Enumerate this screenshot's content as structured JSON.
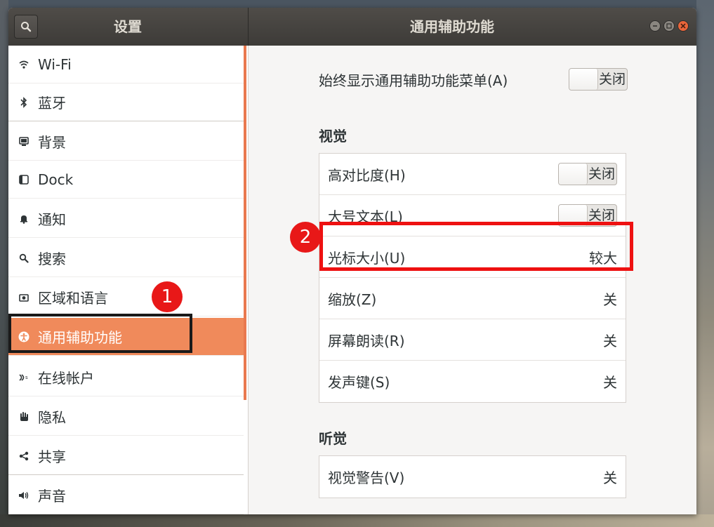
{
  "window": {
    "sidebar_title": "设置",
    "panel_title": "通用辅助功能"
  },
  "sidebar": {
    "items": [
      {
        "label": "Wi-Fi",
        "icon": "wifi-icon"
      },
      {
        "label": "蓝牙",
        "icon": "bluetooth-icon"
      },
      {
        "label": "背景",
        "icon": "background-icon"
      },
      {
        "label": "Dock",
        "icon": "dock-icon"
      },
      {
        "label": "通知",
        "icon": "bell-icon"
      },
      {
        "label": "搜索",
        "icon": "search-icon"
      },
      {
        "label": "区域和语言",
        "icon": "region-icon"
      },
      {
        "label": "通用辅助功能",
        "icon": "accessibility-icon",
        "active": true
      },
      {
        "label": "在线帐户",
        "icon": "online-accounts-icon"
      },
      {
        "label": "隐私",
        "icon": "hand-icon"
      },
      {
        "label": "共享",
        "icon": "share-icon"
      },
      {
        "label": "声音",
        "icon": "speaker-icon"
      }
    ]
  },
  "main": {
    "always_show": {
      "label": "始终显示通用辅助功能菜单(A)",
      "state": "关闭"
    },
    "vision": {
      "title": "视觉",
      "rows": [
        {
          "label": "高对比度(H)",
          "state": "关闭"
        },
        {
          "label": "大号文本(L)",
          "state": "关闭"
        },
        {
          "label": "光标大小(U)",
          "value": "较大"
        },
        {
          "label": "缩放(Z)",
          "value": "关"
        },
        {
          "label": "屏幕朗读(R)",
          "value": "关"
        },
        {
          "label": "发声键(S)",
          "value": "关"
        }
      ]
    },
    "hearing": {
      "title": "听觉",
      "rows": [
        {
          "label": "视觉警告(V)",
          "value": "关"
        }
      ]
    }
  },
  "annotations": {
    "badge_1": "1",
    "badge_2": "2"
  },
  "colors": {
    "accent": "#f08a5b",
    "titlebar": "#3d3b38",
    "annotation_red": "#e81818"
  }
}
